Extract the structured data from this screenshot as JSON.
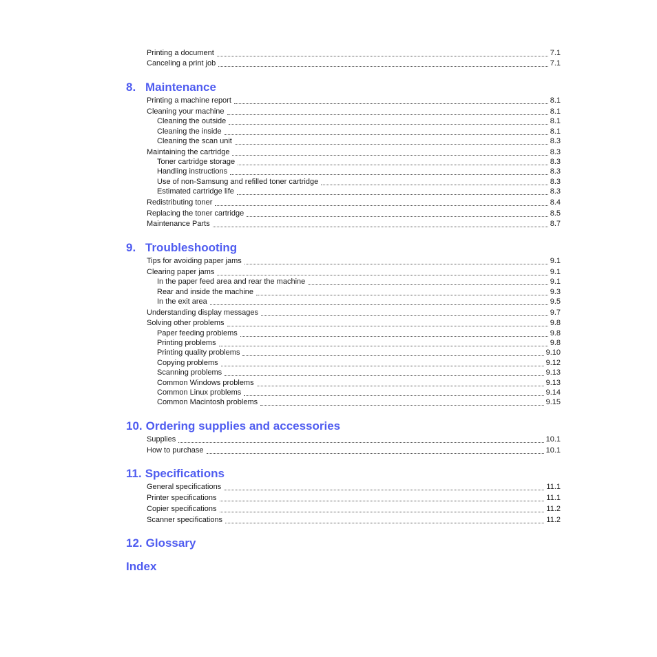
{
  "colors": {
    "heading": "#4f5cf0",
    "text": "#1a1a1a"
  },
  "intro_entries": [
    {
      "title": "Printing a document",
      "page": "7.1"
    },
    {
      "title": "Canceling a print job",
      "page": "7.1"
    }
  ],
  "sections": [
    {
      "number": "8.",
      "title": "Maintenance",
      "entries": [
        {
          "title": "Printing a machine report",
          "page": "8.1",
          "level": 1
        },
        {
          "title": "Cleaning your machine",
          "page": "8.1",
          "level": 1
        },
        {
          "title": "Cleaning the outside",
          "page": "8.1",
          "level": 2
        },
        {
          "title": "Cleaning the inside",
          "page": "8.1",
          "level": 2
        },
        {
          "title": "Cleaning the scan unit",
          "page": "8.3",
          "level": 2
        },
        {
          "title": "Maintaining the cartridge",
          "page": "8.3",
          "level": 1
        },
        {
          "title": "Toner cartridge storage",
          "page": "8.3",
          "level": 2
        },
        {
          "title": "Handling instructions",
          "page": "8.3",
          "level": 2
        },
        {
          "title": "Use of non-Samsung and refilled toner cartridge",
          "page": "8.3",
          "level": 2
        },
        {
          "title": "Estimated cartridge life",
          "page": "8.3",
          "level": 2
        },
        {
          "title": "Redistributing toner",
          "page": "8.4",
          "level": 1
        },
        {
          "title": "Replacing the toner cartridge",
          "page": "8.5",
          "level": 1
        },
        {
          "title": "Maintenance Parts",
          "page": "8.7",
          "level": 1
        }
      ]
    },
    {
      "number": "9.",
      "title": "Troubleshooting",
      "entries": [
        {
          "title": "Tips for avoiding paper jams",
          "page": "9.1",
          "level": 1
        },
        {
          "title": "Clearing paper jams",
          "page": "9.1",
          "level": 1
        },
        {
          "title": "In the paper feed area and rear the machine",
          "page": "9.1",
          "level": 2
        },
        {
          "title": "Rear and inside the machine",
          "page": "9.3",
          "level": 2
        },
        {
          "title": "In the exit area",
          "page": "9.5",
          "level": 2
        },
        {
          "title": "Understanding display messages",
          "page": "9.7",
          "level": 1
        },
        {
          "title": "Solving other problems",
          "page": "9.8",
          "level": 1
        },
        {
          "title": "Paper feeding problems",
          "page": "9.8",
          "level": 2
        },
        {
          "title": "Printing problems",
          "page": "9.8",
          "level": 2
        },
        {
          "title": "Printing quality problems",
          "page": "9.10",
          "level": 2
        },
        {
          "title": "Copying problems",
          "page": "9.12",
          "level": 2
        },
        {
          "title": "Scanning problems",
          "page": "9.13",
          "level": 2
        },
        {
          "title": "Common Windows problems",
          "page": "9.13",
          "level": 2
        },
        {
          "title": "Common Linux problems",
          "page": "9.14",
          "level": 2
        },
        {
          "title": "Common Macintosh problems",
          "page": "9.15",
          "level": 2
        }
      ]
    },
    {
      "number": "10.",
      "title": "Ordering supplies and accessories",
      "entries": [
        {
          "title": "Supplies",
          "page": "10.1",
          "level": 1
        },
        {
          "title": "How to purchase",
          "page": "10.1",
          "level": 1
        }
      ]
    },
    {
      "number": "11.",
      "title": "Specifications",
      "entries": [
        {
          "title": "General specifications",
          "page": "11.1",
          "level": 1
        },
        {
          "title": "Printer specifications",
          "page": "11.1",
          "level": 1
        },
        {
          "title": "Copier specifications",
          "page": "11.2",
          "level": 1
        },
        {
          "title": "Scanner specifications",
          "page": "11.2",
          "level": 1
        }
      ]
    },
    {
      "number": "12.",
      "title": "Glossary",
      "entries": []
    },
    {
      "number": "",
      "title": "Index",
      "entries": []
    }
  ]
}
